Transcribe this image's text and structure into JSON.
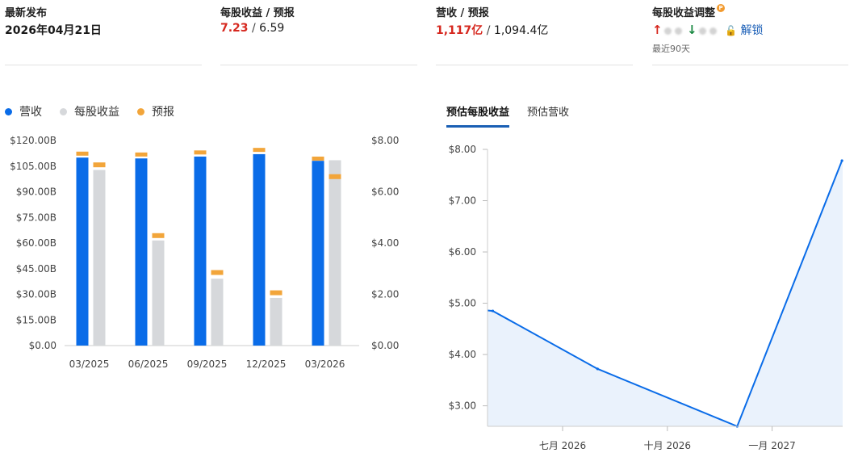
{
  "summary": {
    "release": {
      "label": "最新发布",
      "value": "2026年04月21日"
    },
    "eps": {
      "label": "每股收益 / 预报",
      "actual": "7.23",
      "separator": " / ",
      "forecast": "6.59"
    },
    "revenue": {
      "label": "营收 / 预报",
      "actual": "1,117亿",
      "separator": " / ",
      "forecast": "1,094.4亿"
    },
    "revision": {
      "label": "每股收益调整",
      "unlock_label": "解锁",
      "period": "最近90天"
    }
  },
  "legend": [
    {
      "label": "营收",
      "color": "#0a6ce8"
    },
    {
      "label": "每股收益",
      "color": "#d6d8db"
    },
    {
      "label": "预报",
      "color": "#f2a53a"
    }
  ],
  "tabs": [
    {
      "label": "预估每股收益",
      "active": true
    },
    {
      "label": "预估营收",
      "active": false
    }
  ],
  "chart_data": [
    {
      "type": "bar",
      "categories": [
        "03/2025",
        "06/2025",
        "09/2025",
        "12/2025",
        "03/2026"
      ],
      "series": [
        {
          "name": "营收",
          "axis": "left",
          "values": [
            110.0,
            109.5,
            110.6,
            112.0,
            108.1
          ],
          "color": "#0a6ce8"
        },
        {
          "name": "每股收益",
          "axis": "right",
          "values": [
            6.85,
            4.1,
            2.61,
            1.86,
            7.23
          ],
          "color": "#d6d8db"
        }
      ],
      "forecast": {
        "name": "预报",
        "color": "#f2a53a",
        "revenue": [
          112.3,
          111.8,
          113.0,
          114.5,
          109.4
        ],
        "eps": [
          7.05,
          4.29,
          2.85,
          2.06,
          6.59
        ]
      },
      "left_axis": {
        "ylim": [
          0,
          120
        ],
        "ticks": [
          "$0.00",
          "$15.00B",
          "$30.00B",
          "$45.00B",
          "$60.00B",
          "$75.00B",
          "$90.00B",
          "$105.00B",
          "$120.00B"
        ]
      },
      "right_axis": {
        "ylim": [
          0,
          8
        ],
        "ticks": [
          "$0.00",
          "$2.00",
          "$4.00",
          "$6.00",
          "$8.00"
        ]
      }
    },
    {
      "type": "area",
      "x": [
        "2026-05",
        "2026-08",
        "2026-12",
        "2027-03"
      ],
      "values": [
        4.85,
        3.72,
        2.6,
        7.78
      ],
      "ylim": [
        2.6,
        8.0
      ],
      "yticks": [
        "$3.00",
        "$4.00",
        "$5.00",
        "$6.00",
        "$7.00",
        "$8.00"
      ],
      "xticks": [
        "七月 2026",
        "十月 2026",
        "一月 2027"
      ],
      "color": "#0a6ce8",
      "fill": "#eaf2fc"
    }
  ]
}
